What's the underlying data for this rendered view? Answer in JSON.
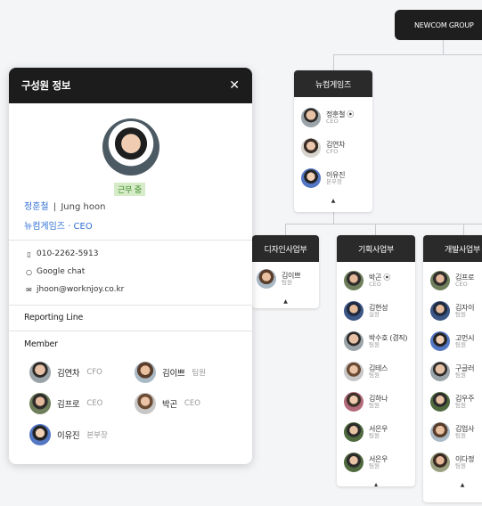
{
  "panel": {
    "title": "구성원 정보",
    "close_icon": "close-icon",
    "status": "근무 중",
    "name_ko": "정훈철",
    "name_sep": "|",
    "name_en": "Jung hoon",
    "org": "뉴컴게임즈 · CEO",
    "phone": "010-2262-5913",
    "chat": "Google chat",
    "email": "jhoon@worknjoy.co.kr",
    "reporting": "Reporting Line",
    "member_heading": "Member",
    "members": [
      {
        "name": "김연차",
        "title": "CFO"
      },
      {
        "name": "김이쁘",
        "title": "팀원"
      },
      {
        "name": "김프로",
        "title": "CEO"
      },
      {
        "name": "박곤",
        "title": "CEO"
      },
      {
        "name": "이유진",
        "title": "본부장"
      }
    ]
  },
  "org": {
    "root": "NEWCOM GROUP",
    "company": {
      "name": "뉴컴게임즈",
      "people": [
        {
          "name": "정훈철 ⦿",
          "title": "CEO"
        },
        {
          "name": "김연차",
          "title": "CFO"
        },
        {
          "name": "이유진",
          "title": "본부장"
        }
      ]
    },
    "design": {
      "name": "디자인사업부",
      "people": [
        {
          "name": "김이쁘",
          "title": "팀원"
        }
      ]
    },
    "planning": {
      "name": "기획사업부",
      "people": [
        {
          "name": "박곤 ⦿",
          "title": "CEO"
        },
        {
          "name": "김현성",
          "title": "실장"
        },
        {
          "name": "박수호 (겸직)",
          "title": "팀원"
        },
        {
          "name": "김테스",
          "title": "팀원"
        },
        {
          "name": "김하나",
          "title": "팀원"
        },
        {
          "name": "서은우",
          "title": "팀원"
        },
        {
          "name": "서은우",
          "title": "팀원"
        }
      ]
    },
    "dev": {
      "name": "개발사업부",
      "people": [
        {
          "name": "김프로",
          "title": "CEO"
        },
        {
          "name": "김자이",
          "title": "팀원"
        },
        {
          "name": "고먼시",
          "title": "팀원"
        },
        {
          "name": "구글러",
          "title": "팀원"
        },
        {
          "name": "김우주",
          "title": "팀원"
        },
        {
          "name": "김업사",
          "title": "팀원"
        },
        {
          "name": "이다정",
          "title": "팀원"
        }
      ]
    },
    "collapse_glyph": "▲"
  }
}
